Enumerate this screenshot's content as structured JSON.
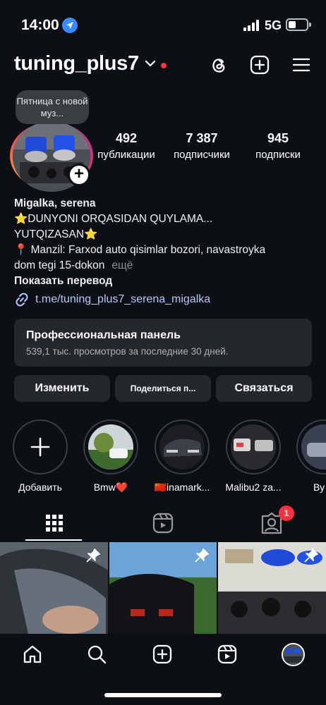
{
  "status_bar": {
    "time": "14:00",
    "network": "5G"
  },
  "header": {
    "username": "tuning_plus7"
  },
  "profile": {
    "note": "Пятница с новой муз...",
    "stats": [
      {
        "value": "492",
        "label": "публикации"
      },
      {
        "value": "7 387",
        "label": "подписчики"
      },
      {
        "value": "945",
        "label": "подписки"
      }
    ],
    "name": "Migalka, serena",
    "bio_line1": "⭐DUNYONI ORQASIDAN QUYLAMA...",
    "bio_line2": "YUTQIZASAN⭐",
    "bio_line3": "📍 Manzil: Farxod auto qisimlar bozori, navastroyka",
    "bio_line4": "dom tegi 15-dokon",
    "more_label": "ещё",
    "translate_label": "Показать перевод",
    "link": "t.me/tuning_plus7_serena_migalka"
  },
  "dashboard": {
    "title": "Профессиональная панель",
    "subtitle": "539,1 тыс. просмотров за последние 30 дней."
  },
  "buttons": {
    "edit": "Изменить",
    "share": "Поделиться п...",
    "contact": "Связаться"
  },
  "highlights": [
    {
      "label": "Добавить"
    },
    {
      "label": "Bmw❤️"
    },
    {
      "label": "🇨🇳inamark..."
    },
    {
      "label": "Malibu2 za..."
    },
    {
      "label": "Ву"
    }
  ],
  "tabs": {
    "tagged_badge": "1"
  }
}
